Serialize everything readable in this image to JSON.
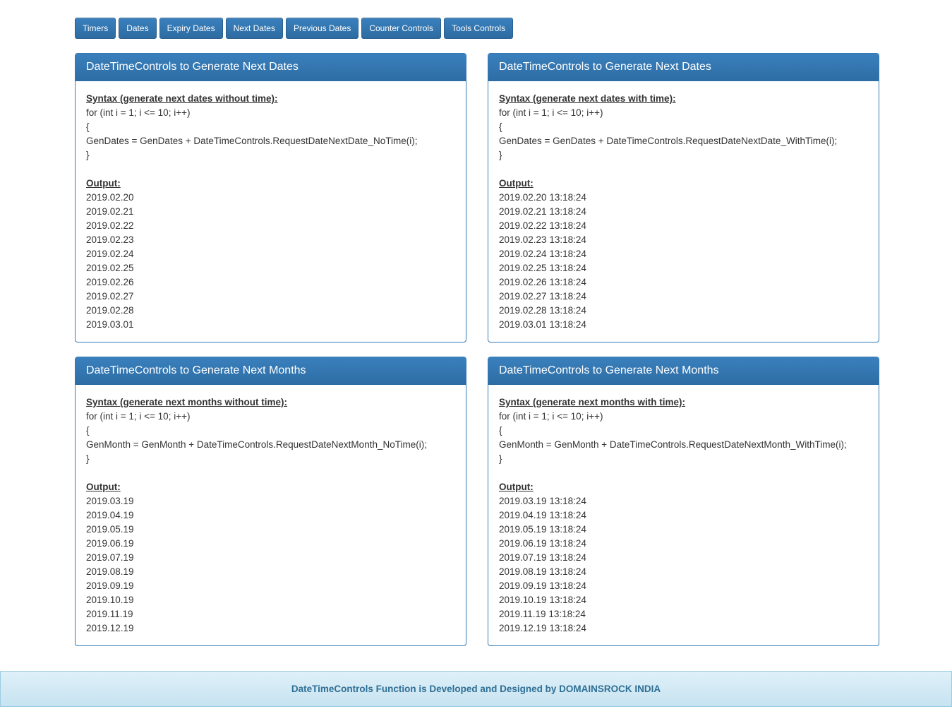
{
  "nav": {
    "buttons": [
      "Timers",
      "Dates",
      "Expiry Dates",
      "Next Dates",
      "Previous Dates",
      "Counter Controls",
      "Tools Controls"
    ]
  },
  "panels": [
    {
      "title": "DateTimeControls to Generate Next Dates",
      "syntax_title": "Syntax (generate next dates without time):",
      "code": [
        "for (int i = 1; i <= 10; i++)",
        "{",
        "GenDates = GenDates + DateTimeControls.RequestDateNextDate_NoTime(i);",
        "}"
      ],
      "output_title": "Output:",
      "output": [
        "2019.02.20",
        "2019.02.21",
        "2019.02.22",
        "2019.02.23",
        "2019.02.24",
        "2019.02.25",
        "2019.02.26",
        "2019.02.27",
        "2019.02.28",
        "2019.03.01"
      ]
    },
    {
      "title": "DateTimeControls to Generate Next Dates",
      "syntax_title": "Syntax (generate next dates with time):",
      "code": [
        "for (int i = 1; i <= 10; i++)",
        "{",
        "GenDates = GenDates + DateTimeControls.RequestDateNextDate_WithTime(i);",
        "}"
      ],
      "output_title": "Output:",
      "output": [
        "2019.02.20 13:18:24",
        "2019.02.21 13:18:24",
        "2019.02.22 13:18:24",
        "2019.02.23 13:18:24",
        "2019.02.24 13:18:24",
        "2019.02.25 13:18:24",
        "2019.02.26 13:18:24",
        "2019.02.27 13:18:24",
        "2019.02.28 13:18:24",
        "2019.03.01 13:18:24"
      ]
    },
    {
      "title": "DateTimeControls to Generate Next Months",
      "syntax_title": "Syntax (generate next months without time):",
      "code": [
        "for (int i = 1; i <= 10; i++)",
        "{",
        "GenMonth = GenMonth + DateTimeControls.RequestDateNextMonth_NoTime(i);",
        "}"
      ],
      "output_title": "Output:",
      "output": [
        "2019.03.19",
        "2019.04.19",
        "2019.05.19",
        "2019.06.19",
        "2019.07.19",
        "2019.08.19",
        "2019.09.19",
        "2019.10.19",
        "2019.11.19",
        "2019.12.19"
      ]
    },
    {
      "title": "DateTimeControls to Generate Next Months",
      "syntax_title": "Syntax (generate next months with time):",
      "code": [
        "for (int i = 1; i <= 10; i++)",
        "{",
        "GenMonth = GenMonth + DateTimeControls.RequestDateNextMonth_WithTime(i);",
        "}"
      ],
      "output_title": "Output:",
      "output": [
        "2019.03.19 13:18:24",
        "2019.04.19 13:18:24",
        "2019.05.19 13:18:24",
        "2019.06.19 13:18:24",
        "2019.07.19 13:18:24",
        "2019.08.19 13:18:24",
        "2019.09.19 13:18:24",
        "2019.10.19 13:18:24",
        "2019.11.19 13:18:24",
        "2019.12.19 13:18:24"
      ]
    }
  ],
  "footer": {
    "text": "DateTimeControls Function is Developed and Designed by DOMAINSROCK INDIA"
  }
}
